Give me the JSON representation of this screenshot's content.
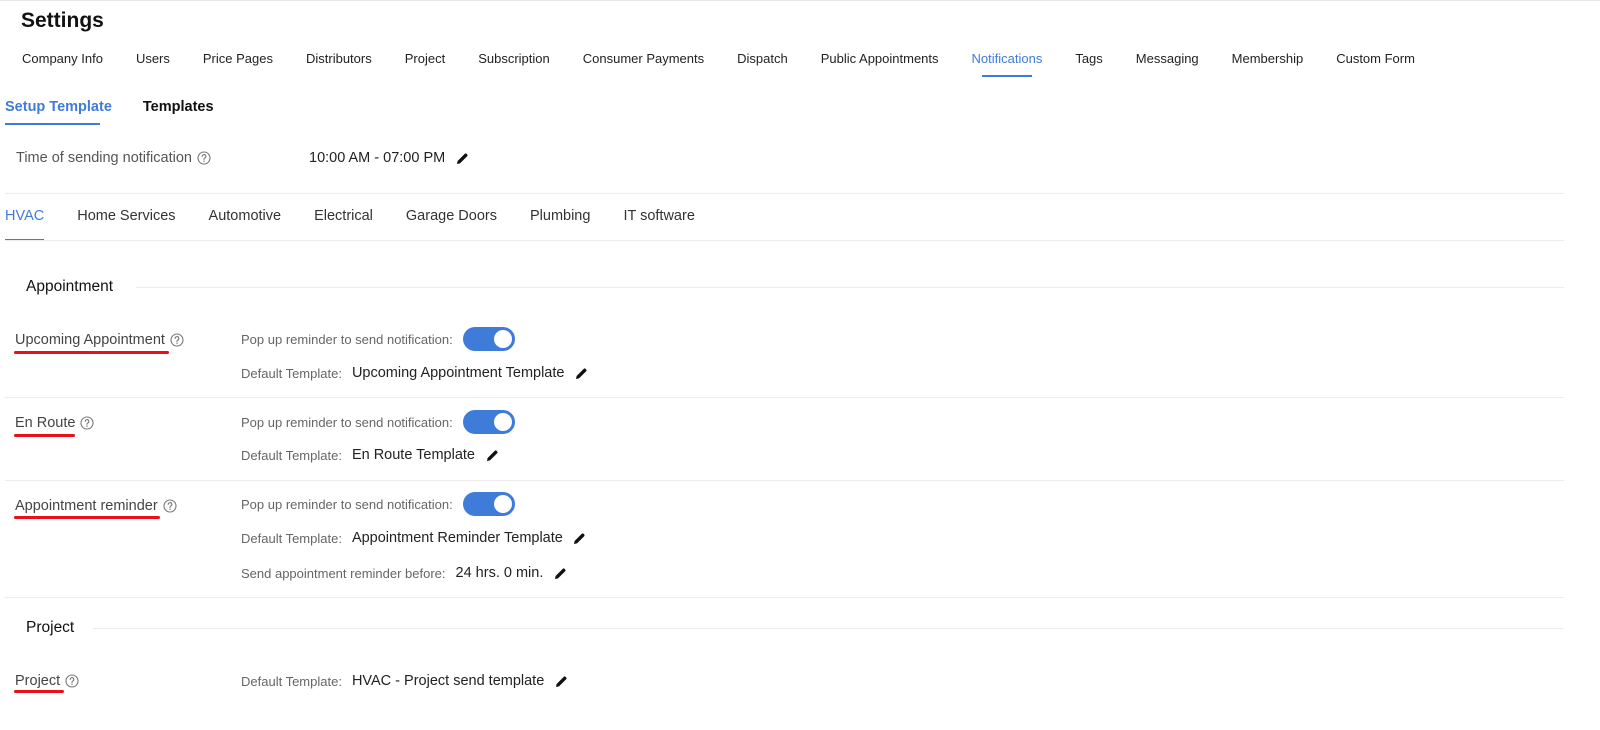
{
  "page_title": "Settings",
  "main_tabs": [
    {
      "label": "Company Info"
    },
    {
      "label": "Users"
    },
    {
      "label": "Price Pages"
    },
    {
      "label": "Distributors"
    },
    {
      "label": "Project"
    },
    {
      "label": "Subscription"
    },
    {
      "label": "Consumer Payments"
    },
    {
      "label": "Dispatch"
    },
    {
      "label": "Public Appointments"
    },
    {
      "label": "Notifications",
      "active": true
    },
    {
      "label": "Tags"
    },
    {
      "label": "Messaging"
    },
    {
      "label": "Membership"
    },
    {
      "label": "Custom Form"
    }
  ],
  "sub_tabs": [
    {
      "label": "Setup Template",
      "active": true
    },
    {
      "label": "Templates"
    }
  ],
  "time_setting": {
    "label": "Time of sending notification",
    "value": "10:00 AM - 07:00 PM"
  },
  "category_tabs": [
    {
      "label": "HVAC",
      "active": true
    },
    {
      "label": "Home Services"
    },
    {
      "label": "Automotive"
    },
    {
      "label": "Electrical"
    },
    {
      "label": "Garage Doors"
    },
    {
      "label": "Plumbing"
    },
    {
      "label": "IT software"
    }
  ],
  "sections": {
    "appointment": {
      "title": "Appointment",
      "rows": [
        {
          "label": "Upcoming Appointment",
          "popup_label": "Pop up reminder to send notification:",
          "popup_enabled": true,
          "template_label": "Default Template:",
          "template_value": "Upcoming Appointment Template"
        },
        {
          "label": "En Route",
          "popup_label": "Pop up reminder to send notification:",
          "popup_enabled": true,
          "template_label": "Default Template:",
          "template_value": "En Route Template"
        },
        {
          "label": "Appointment reminder",
          "popup_label": "Pop up reminder to send notification:",
          "popup_enabled": true,
          "template_label": "Default Template:",
          "template_value": "Appointment Reminder Template",
          "before_label": "Send appointment reminder before:",
          "before_value": "24 hrs. 0 min."
        }
      ]
    },
    "project": {
      "title": "Project",
      "rows": [
        {
          "label": "Project",
          "template_label": "Default Template:",
          "template_value": "HVAC - Project send template"
        }
      ]
    }
  },
  "colors": {
    "accent": "#3f7bd9",
    "annotation_underline": "#e8101a"
  },
  "icons": {
    "help": "help-circle-icon",
    "edit": "pencil-icon"
  }
}
